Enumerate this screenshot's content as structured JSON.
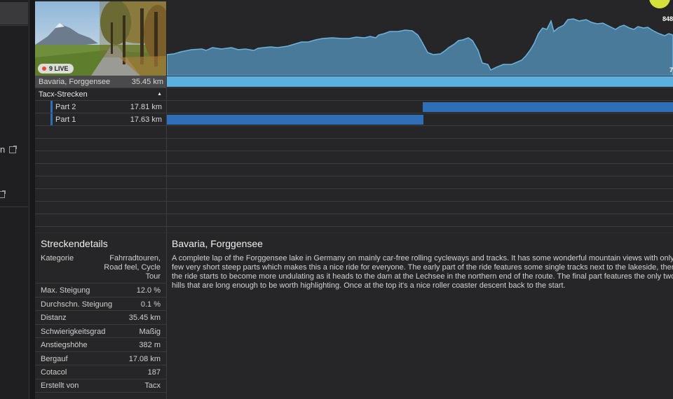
{
  "sidebar": {
    "fragment_1": "n"
  },
  "thumbnail": {
    "live_label": "9 LIVE"
  },
  "profile": {
    "elevation_max_label": "848",
    "elevation_min_label": "7",
    "color_fill": "#4a7a99",
    "color_line": "#6ab4e0"
  },
  "route": {
    "name": "Bavaria, Forggensee",
    "distance": "35.45 km",
    "bar_color": "#5bb0e0"
  },
  "segments_header": {
    "label": "Tacx-Strecken",
    "toggle": "▲"
  },
  "segments": [
    {
      "name": "Part 2",
      "distance": "17.81 km",
      "start_frac": 0.5,
      "end_frac": 1.0
    },
    {
      "name": "Part 1",
      "distance": "17.63 km",
      "start_frac": 0.0,
      "end_frac": 0.5
    }
  ],
  "segment_bar_color": "#2f6fb8",
  "details": {
    "title": "Streckendetails",
    "rows": [
      {
        "key": "Kategorie",
        "value": "Fahrradtouren, Road feel, Cycle Tour"
      },
      {
        "key": "Max. Steigung",
        "value": "12.0 %"
      },
      {
        "key": "Durchschn. Steigung",
        "value": "0.1 %"
      },
      {
        "key": "Distanz",
        "value": "35.45 km"
      },
      {
        "key": "Schwierigkeitsgrad",
        "value": "Maßig"
      },
      {
        "key": "Anstiegshöhe",
        "value": "382 m"
      },
      {
        "key": "Bergauf",
        "value": "17.08 km"
      },
      {
        "key": "Cotacol",
        "value": "187"
      },
      {
        "key": "Erstellt von",
        "value": "Tacx"
      }
    ]
  },
  "description": {
    "title": "Bavaria, Forggensee",
    "text": "A complete lap of the Forggensee lake in Germany on mainly car-free rolling cycleways and tracks. It has some wonderful mountain views with only a few very short steep parts which makes this a nice ride for everyone. The early part of the ride features some single tracks next to the lakeside, then the ride starts to become more undulating as it heads to the dam at the Lechsee in the northern end of the route. The final part features the only two hills that are long enough to be worth highlighting. Once at the top it's a nice roller coaster descent back to the start."
  }
}
